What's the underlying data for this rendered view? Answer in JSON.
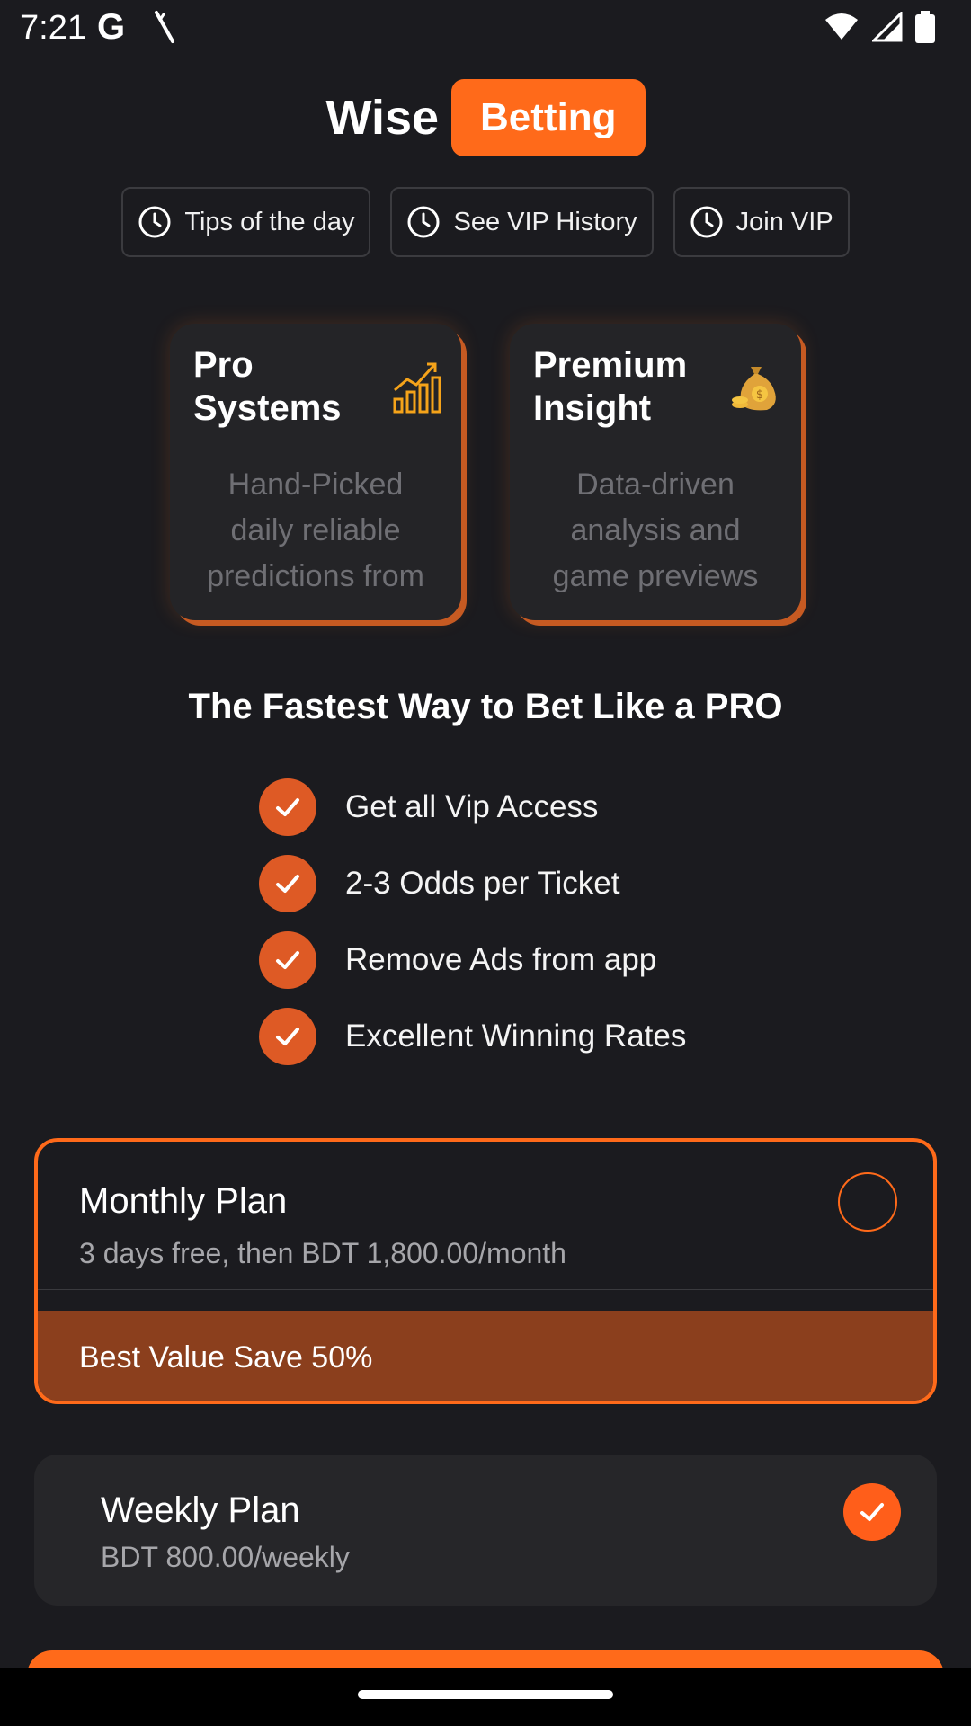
{
  "status": {
    "time": "7:21",
    "google_glyph": "G"
  },
  "brand": {
    "wise": "Wise",
    "betting": "Betting"
  },
  "nav": [
    {
      "label": "Tips of the day"
    },
    {
      "label": "See VIP History"
    },
    {
      "label": "Join VIP"
    }
  ],
  "features": [
    {
      "title": "Pro Systems",
      "icon": "chart-growth-icon",
      "desc": "Hand-Picked daily reliable predictions from"
    },
    {
      "title": "Premium Insight",
      "icon": "money-bag-icon",
      "desc": "Data-driven analysis and game previews"
    }
  ],
  "headline": "The Fastest Way to Bet Like a PRO",
  "benefits": [
    "Get all Vip Access",
    "2-3 Odds per Ticket",
    "Remove Ads from app",
    "Excellent Winning Rates"
  ],
  "plans": {
    "monthly": {
      "title": "Monthly Plan",
      "subtitle": "3 days free, then BDT 1,800.00/month",
      "banner": "Best Value Save 50%"
    },
    "weekly": {
      "title": "Weekly Plan",
      "subtitle": "BDT 800.00/weekly"
    }
  },
  "colors": {
    "accent": "#ff6a1a",
    "banner": "#8b3f1d",
    "background": "#1b1b1f",
    "card": "#242427"
  }
}
